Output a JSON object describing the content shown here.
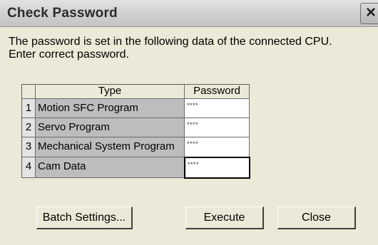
{
  "dialog": {
    "title": "Check Password",
    "message_line1": "The password is set in the following data of the connected CPU.",
    "message_line2": "Enter correct password."
  },
  "table": {
    "headers": {
      "type": "Type",
      "password": "Password"
    },
    "rows": [
      {
        "num": "1",
        "type": "Motion SFC Program",
        "password": "****"
      },
      {
        "num": "2",
        "type": "Servo Program",
        "password": "****"
      },
      {
        "num": "3",
        "type": "Mechanical System Program",
        "password": "****"
      },
      {
        "num": "4",
        "type": "Cam Data",
        "password": "****"
      }
    ]
  },
  "buttons": {
    "batch": "Batch Settings...",
    "execute": "Execute",
    "close": "Close",
    "title_close": "×"
  },
  "colors": {
    "dialog_background": "#ece9d8",
    "type_cell": "#bdbdbd",
    "password_cell": "#ffffff"
  },
  "icons": {
    "title_close": "close-icon"
  }
}
